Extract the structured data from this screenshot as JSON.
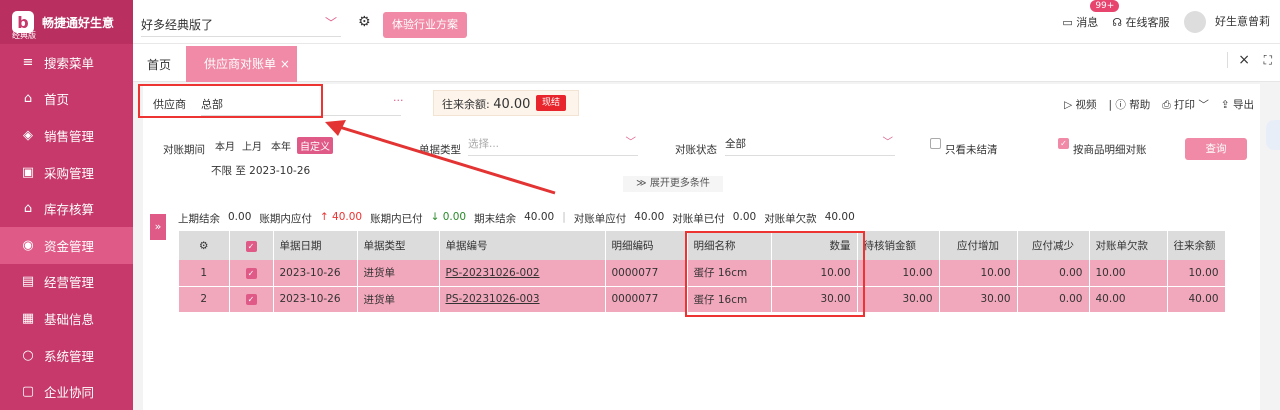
{
  "sidebar": {
    "logo_letter": "b",
    "app_name": "畅捷通好生意",
    "edition": "经典版",
    "items": [
      {
        "icon": "search-menu-icon",
        "glyph": "≡",
        "label": "搜索菜单"
      },
      {
        "icon": "home-icon",
        "glyph": "⌂",
        "label": "首页"
      },
      {
        "icon": "sales-icon",
        "glyph": "◈",
        "label": "销售管理"
      },
      {
        "icon": "purchase-icon",
        "glyph": "▣",
        "label": "采购管理"
      },
      {
        "icon": "inventory-icon",
        "glyph": "⌂",
        "label": "库存核算"
      },
      {
        "icon": "funds-icon",
        "glyph": "◉",
        "label": "资金管理"
      },
      {
        "icon": "operations-icon",
        "glyph": "▤",
        "label": "经营管理"
      },
      {
        "icon": "basic-info-icon",
        "glyph": "▦",
        "label": "基础信息"
      },
      {
        "icon": "system-icon",
        "glyph": "○",
        "label": "系统管理"
      },
      {
        "icon": "collab-icon",
        "glyph": "▢",
        "label": "企业协同"
      }
    ],
    "active_index": 5
  },
  "topbar": {
    "version": "好多经典版了",
    "trial_label": "体验行业方案",
    "message_label": "消息",
    "message_count": "99+",
    "support_label": "在线客服",
    "user_name": "好生意曾莉"
  },
  "tabs": {
    "home": "首页",
    "active": "供应商对账单",
    "active_close": "×",
    "close_all": "×",
    "fullscreen": "⛶"
  },
  "supplier": {
    "label": "供应商",
    "value": "总部",
    "more": "···",
    "balance_label": "往来余额:",
    "balance_value": "40.00",
    "settle_label": "现结"
  },
  "tools": {
    "video": "视频",
    "help": "帮助",
    "print": "打印",
    "export": "导出"
  },
  "filters": {
    "period_label": "对账期间",
    "period_options": [
      "本月",
      "上月",
      "本年",
      "自定义"
    ],
    "period_selected": "自定义",
    "date_range": "不限 至 2023-10-26",
    "doc_type_label": "单据类型",
    "doc_type_placeholder": "选择...",
    "status_label": "对账状态",
    "status_value": "全部",
    "only_unsettled_label": "只看未结清",
    "only_unsettled_checked": false,
    "by_item_label": "按商品明细对账",
    "by_item_checked": true,
    "query_label": "查询",
    "expand_label": "展开更多条件"
  },
  "summary": {
    "opening_label": "上期结余",
    "opening_value": "0.00",
    "payable_label": "账期内应付",
    "payable_value": "40.00",
    "paid_label": "账期内已付",
    "paid_value": "0.00",
    "closing_label": "期末结余",
    "closing_value": "40.00",
    "stmt_payable_label": "对账单应付",
    "stmt_payable_value": "40.00",
    "stmt_paid_label": "对账单已付",
    "stmt_paid_value": "0.00",
    "stmt_owed_label": "对账单欠款",
    "stmt_owed_value": "40.00"
  },
  "table": {
    "headers": [
      "",
      "",
      "单据日期",
      "单据类型",
      "单据编号",
      "明细编码",
      "明细名称",
      "数量",
      "待核销金额",
      "应付增加",
      "应付减少",
      "对账单欠款",
      "往来余额"
    ],
    "rows": [
      {
        "no": "1",
        "checked": true,
        "date": "2023-10-26",
        "type": "进货单",
        "code": "PS-20231026-002",
        "item_code": "0000077",
        "item_name": "蛋仔 16cm",
        "qty": "10.00",
        "pending": "10.00",
        "inc": "10.00",
        "dec": "0.00",
        "owed": "10.00",
        "balance": "10.00"
      },
      {
        "no": "2",
        "checked": true,
        "date": "2023-10-26",
        "type": "进货单",
        "code": "PS-20231026-003",
        "item_code": "0000077",
        "item_name": "蛋仔 16cm",
        "qty": "30.00",
        "pending": "30.00",
        "inc": "30.00",
        "dec": "0.00",
        "owed": "40.00",
        "balance": "40.00"
      }
    ]
  },
  "colors": {
    "sidebar": "#c6396a",
    "accent": "#f08aa6",
    "row_highlight": "#f1a7bc",
    "annotation": "#e33333"
  }
}
